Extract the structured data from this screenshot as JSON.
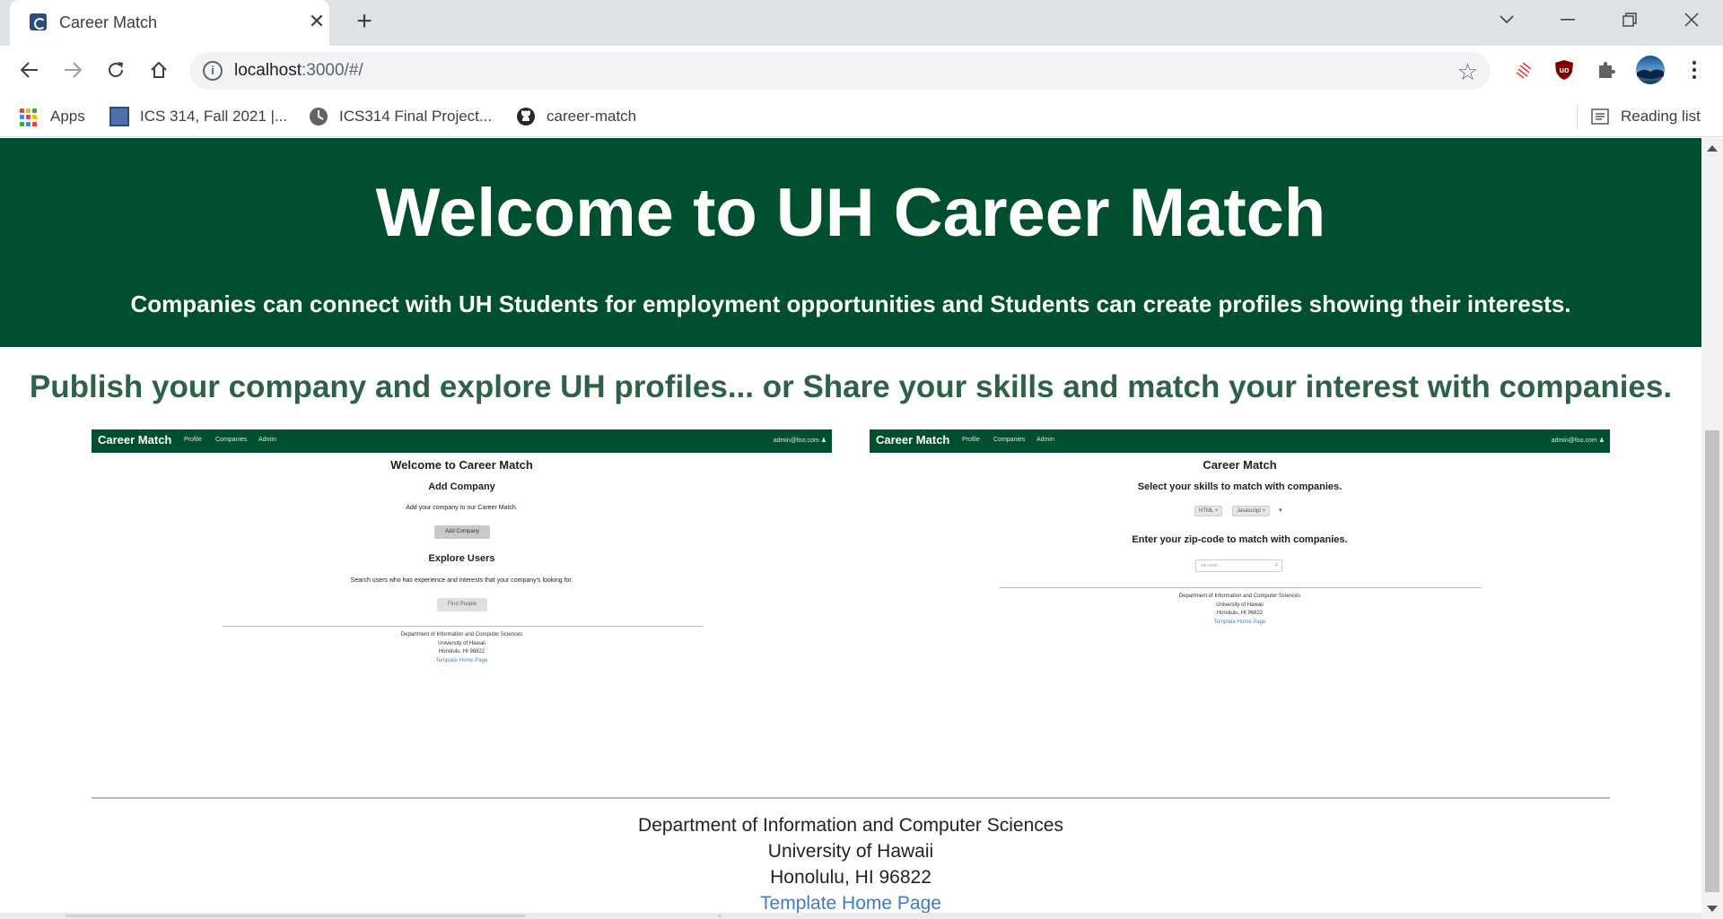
{
  "browser": {
    "tab_title": "Career Match",
    "url_host": "localhost",
    "url_rest": ":3000/#/",
    "bookmarks": [
      {
        "label": "Apps"
      },
      {
        "label": "ICS 314, Fall 2021 |..."
      },
      {
        "label": "ICS314 Final Project..."
      },
      {
        "label": "career-match"
      }
    ],
    "reading_list": "Reading list"
  },
  "hero": {
    "title": "Welcome to UH Career Match",
    "subtitle": "Companies can connect with UH Students for employment opportunities and Students can create profiles showing their interests."
  },
  "tagline": "Publish your company and explore UH profiles... or Share your skills and match your interest with companies.",
  "mini_left": {
    "brand": "Career Match",
    "nav": [
      "Profile",
      "Companies",
      "Admin"
    ],
    "user": "admin@foo.com",
    "heading": "Welcome to Career Match",
    "section1_title": "Add Company",
    "section1_text": "Add your company to our Career Match.",
    "section1_button": "Add Company",
    "section2_title": "Explore Users",
    "section2_text": "Search users who has experience and interests that your company's looking for.",
    "section2_button": "Find People",
    "footer": [
      "Department of Information and Computer Sciences",
      "University of Hawaii",
      "Honolulu, HI 96822",
      "Template Home Page"
    ]
  },
  "mini_right": {
    "brand": "Career Match",
    "nav": [
      "Profile",
      "Companies",
      "Admin"
    ],
    "user": "admin@foo.com",
    "heading": "Career Match",
    "skills_title": "Select your skills to match with companies.",
    "chips": [
      "HTML ×",
      "Javascript ×"
    ],
    "zip_title": "Enter your zip-code to match with companies.",
    "zip_placeholder": "zip-code...",
    "footer": [
      "Department of Information and Computer Sciences",
      "University of Hawaii",
      "Honolulu, HI 96822",
      "Template Home Page"
    ]
  },
  "footer": {
    "line1": "Department of Information and Computer Sciences",
    "line2": "University of Hawaii",
    "line3": "Honolulu, HI 96822",
    "link": "Template Home Page"
  },
  "colors": {
    "brand_green": "#004f2f",
    "tagline_green": "#2f6148",
    "link_blue": "#3d7bd0"
  }
}
